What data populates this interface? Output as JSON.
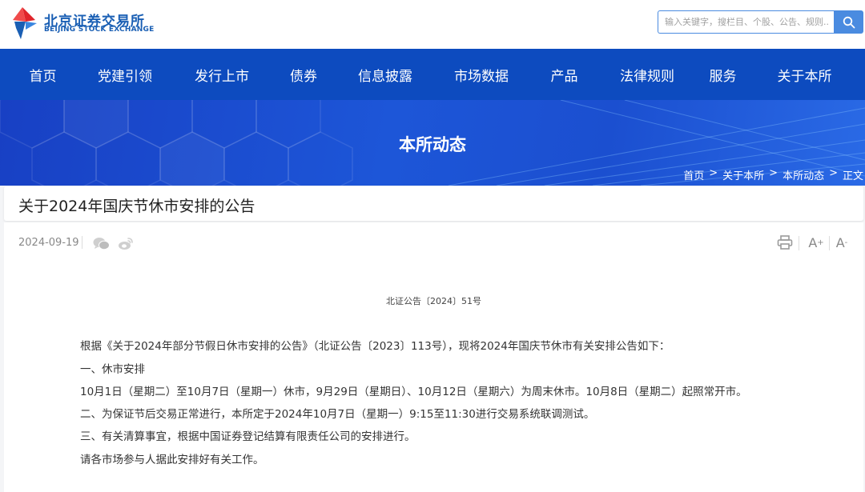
{
  "header": {
    "logo_cn": "北京证券交易所",
    "logo_en": "BEIJING STOCK EXCHANGE",
    "search_placeholder": "输入关键字，搜栏目、个股、公告、规则..."
  },
  "nav": {
    "items": [
      "首页",
      "党建引领",
      "发行上市",
      "债券",
      "信息披露",
      "市场数据",
      "产品",
      "法律规则",
      "服务",
      "关于本所"
    ]
  },
  "banner": {
    "title": "本所动态",
    "breadcrumb": [
      "首页",
      ">",
      "关于本所",
      ">",
      "本所动态",
      ">",
      "正文"
    ]
  },
  "article": {
    "title": "关于2024年国庆节休市安排的公告",
    "date": "2024-09-19",
    "doc_number": "北证公告〔2024〕51号",
    "paragraphs": [
      "根据《关于2024年部分节假日休市安排的公告》（北证公告〔2023〕113号），现将2024年国庆节休市有关安排公告如下：",
      "一、休市安排",
      "10月1日（星期二）至10月7日（星期一）休市，9月29日（星期日）、10月12日（星期六）为周末休市。10月8日（星期二）起照常开市。",
      "二、为保证节后交易正常进行，本所定于2024年10月7日（星期一）9:15至11:30进行交易系统联调测试。",
      "三、有关清算事宜，根据中国证券登记结算有限责任公司的安排进行。",
      "请各市场参与人据此安排好有关工作。"
    ],
    "tools": {
      "font_larger": "A",
      "font_larger_sup": "+",
      "font_smaller": "A",
      "font_smaller_sup": "-"
    }
  },
  "colors": {
    "brand_blue": "#0d4bbf",
    "search_blue": "#4a8be0",
    "logo_red": "#e0252b"
  }
}
